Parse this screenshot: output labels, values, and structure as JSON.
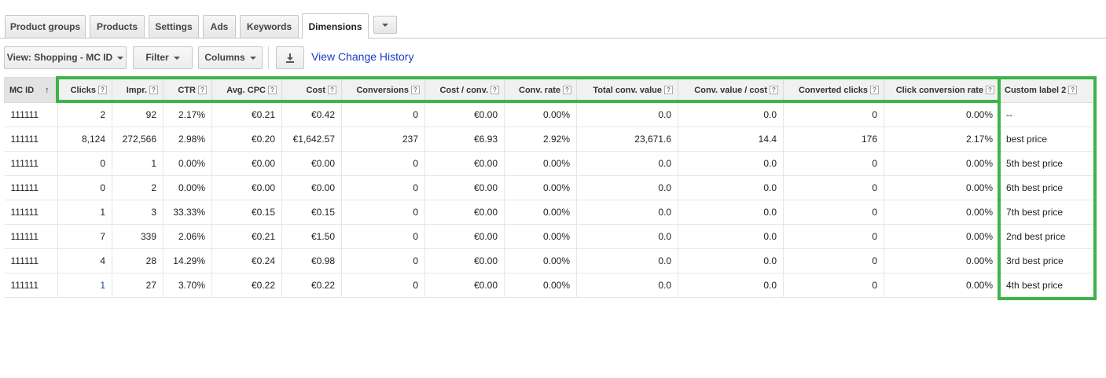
{
  "tabs": [
    {
      "label": "Product groups"
    },
    {
      "label": "Products"
    },
    {
      "label": "Settings"
    },
    {
      "label": "Ads"
    },
    {
      "label": "Keywords"
    },
    {
      "label": "Dimensions",
      "active": true
    }
  ],
  "toolbar": {
    "view_label": "View: Shopping - MC ID",
    "filter_label": "Filter",
    "columns_label": "Columns",
    "download_icon": "download-icon",
    "history_link": "View Change History"
  },
  "table": {
    "columns": [
      "MC ID",
      "Clicks",
      "Impr.",
      "CTR",
      "Avg. CPC",
      "Cost",
      "Conversions",
      "Cost / conv.",
      "Conv. rate",
      "Total conv. value",
      "Conv. value / cost",
      "Converted clicks",
      "Click conversion rate",
      "Custom label 2"
    ],
    "sort_indicator": "↑",
    "help_glyph": "?",
    "rows": [
      [
        "111111",
        "2",
        "92",
        "2.17%",
        "€0.21",
        "€0.42",
        "0",
        "€0.00",
        "0.00%",
        "0.0",
        "0.0",
        "0",
        "0.00%",
        "--"
      ],
      [
        "111111",
        "8,124",
        "272,566",
        "2.98%",
        "€0.20",
        "€1,642.57",
        "237",
        "€6.93",
        "2.92%",
        "23,671.6",
        "14.4",
        "176",
        "2.17%",
        "best price"
      ],
      [
        "111111",
        "0",
        "1",
        "0.00%",
        "€0.00",
        "€0.00",
        "0",
        "€0.00",
        "0.00%",
        "0.0",
        "0.0",
        "0",
        "0.00%",
        "5th best price"
      ],
      [
        "111111",
        "0",
        "2",
        "0.00%",
        "€0.00",
        "€0.00",
        "0",
        "€0.00",
        "0.00%",
        "0.0",
        "0.0",
        "0",
        "0.00%",
        "6th best price"
      ],
      [
        "111111",
        "1",
        "3",
        "33.33%",
        "€0.15",
        "€0.15",
        "0",
        "€0.00",
        "0.00%",
        "0.0",
        "0.0",
        "0",
        "0.00%",
        "7th best price"
      ],
      [
        "111111",
        "7",
        "339",
        "2.06%",
        "€0.21",
        "€1.50",
        "0",
        "€0.00",
        "0.00%",
        "0.0",
        "0.0",
        "0",
        "0.00%",
        "2nd best price"
      ],
      [
        "111111",
        "4",
        "28",
        "14.29%",
        "€0.24",
        "€0.98",
        "0",
        "€0.00",
        "0.00%",
        "0.0",
        "0.0",
        "0",
        "0.00%",
        "3rd best price"
      ],
      [
        "111111",
        "1",
        "27",
        "3.70%",
        "€0.22",
        "€0.22",
        "0",
        "€0.00",
        "0.00%",
        "0.0",
        "0.0",
        "0",
        "0.00%",
        "4th best price"
      ]
    ]
  },
  "colors": {
    "highlight": "#3db34a",
    "link": "#1a3cc7"
  }
}
